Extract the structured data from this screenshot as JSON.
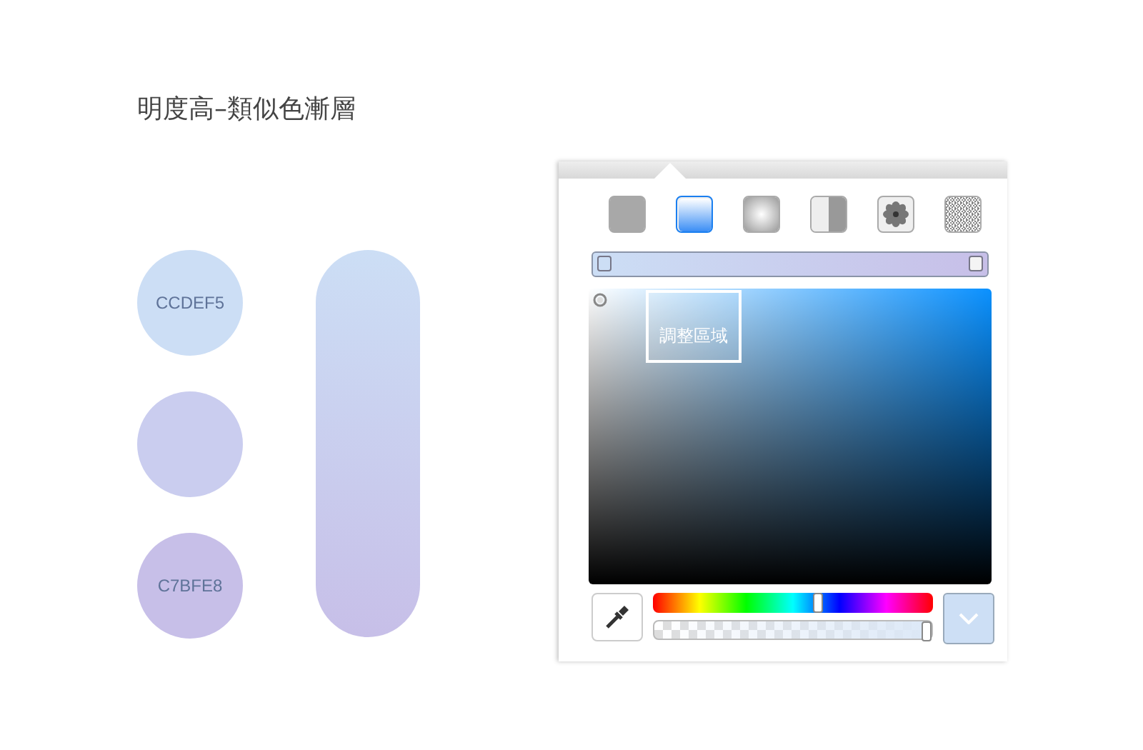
{
  "title": "明度高–類似色漸層",
  "swatches": [
    {
      "label": "CCDEF5",
      "color": "#ccdef5"
    },
    {
      "color": "#cacdef"
    },
    {
      "label": "C7BFE8",
      "color": "#c7bfe8"
    }
  ],
  "picker": {
    "fill_types": [
      {
        "kind": "solid",
        "selected": false
      },
      {
        "kind": "linear",
        "selected": true
      },
      {
        "kind": "radial",
        "selected": false
      },
      {
        "kind": "angular",
        "selected": false
      },
      {
        "kind": "pattern",
        "selected": false
      },
      {
        "kind": "noise",
        "selected": false
      }
    ],
    "color_field": {
      "label": "調整區域"
    },
    "hue": {
      "level": 0.59
    },
    "alpha": {
      "level": 1
    }
  }
}
